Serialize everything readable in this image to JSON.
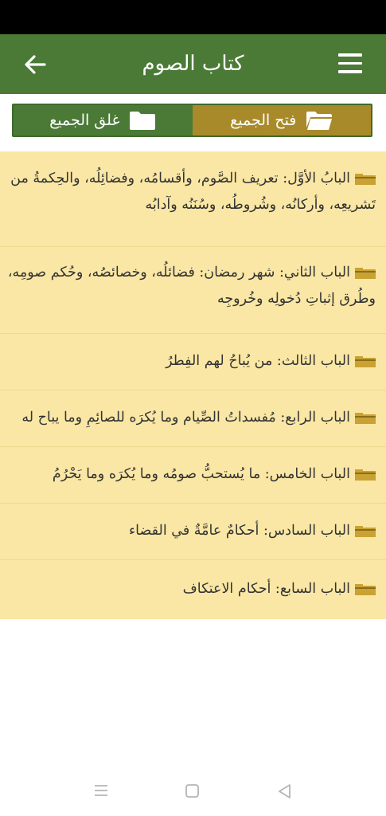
{
  "app_bar": {
    "title": "كتاب الصوم",
    "back_icon": "arrow-left-icon",
    "menu_icon": "hamburger-menu-icon"
  },
  "actions": {
    "open_all_label": "فتح الجميع",
    "close_all_label": "غلق الجميع",
    "open_color": "#a98a2a",
    "close_color": "#4a7a36"
  },
  "chapters": [
    {
      "title": "البابُ الأوَّل: تعريف الصَّوم، وأقسامُه، وفضائِلُه، والحِكمةُ من تَشريعِه، وأركانُه، وشُروطُه، وسُنَنُه وآدابُه"
    },
    {
      "title": "الباب الثاني: شهر رمضان: فضائلُه، وخصائصُه، وحُكم صومِه، وطُرق إثباتِ دُخولِه وخُروجِه"
    },
    {
      "title": "الباب الثالث: من يُباحُ لهم الفِطرُ"
    },
    {
      "title": "الباب الرابع: مُفسداتُ الصِّيام وما يُكرَه للصائِمِ وما يباح له"
    },
    {
      "title": "الباب الخامس: ما يُستحبُّ صومُه وما يُكرَه وما يَحْرُمُ"
    },
    {
      "title": "الباب السادس: أحكامٌ عامَّةٌ في القضاء"
    },
    {
      "title": "الباب السابع: أحكام الاعتكاف"
    }
  ],
  "colors": {
    "app_bar": "#4a7a36",
    "list_background": "#fae7a5",
    "folder_icon": "#c9a233"
  }
}
